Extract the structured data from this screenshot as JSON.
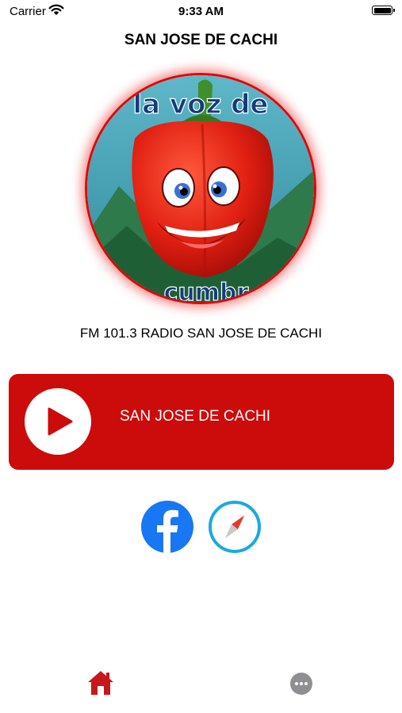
{
  "status_bar": {
    "carrier": "Carrier",
    "time": "9:33 AM"
  },
  "header": {
    "title": "SAN JOSE DE CACHI"
  },
  "logo": {
    "top_text": "la voz de",
    "bottom_text": "cumbr"
  },
  "station": {
    "name": "FM 101.3 RADIO SAN JOSE DE CACHI"
  },
  "player": {
    "label": "SAN JOSE DE CACHI",
    "state": "paused"
  },
  "social": {
    "facebook_icon": "facebook-icon",
    "web_icon": "compass-icon"
  },
  "tabbar": {
    "home_icon": "home-icon",
    "more_icon": "more-icon"
  },
  "colors": {
    "accent": "#cc0b0b",
    "facebook": "#1877f2",
    "safari": "#1ba9e1",
    "tab_active": "#c8161d",
    "tab_inactive": "#8e8e93"
  }
}
